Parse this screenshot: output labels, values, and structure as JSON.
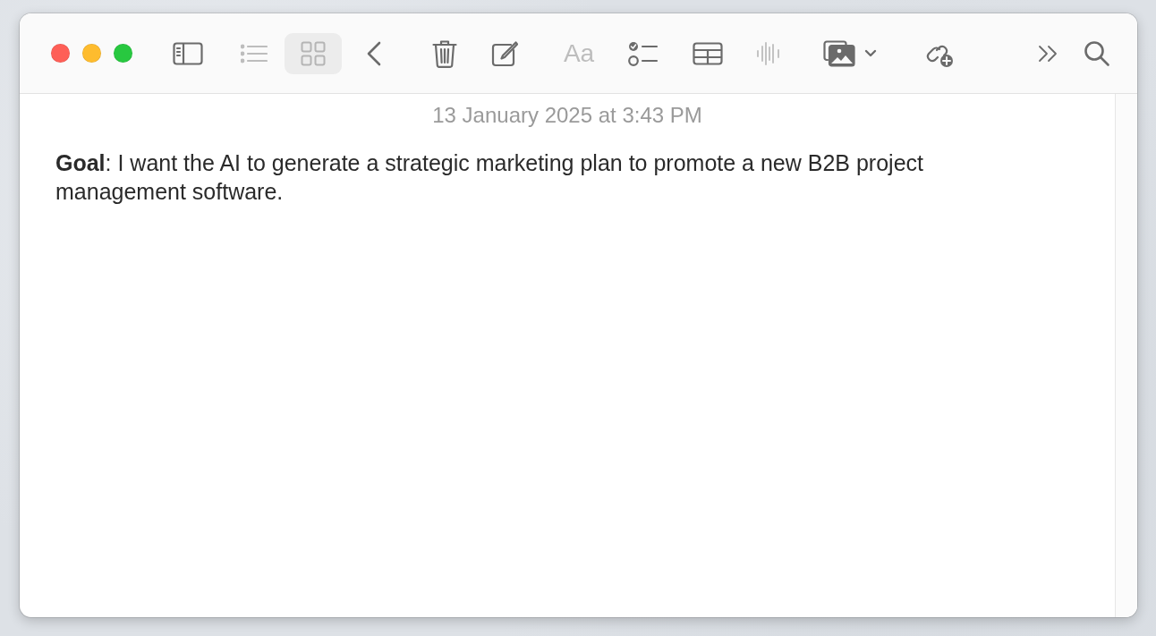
{
  "window": {
    "controls": [
      {
        "kind": "close"
      },
      {
        "kind": "minimize"
      },
      {
        "kind": "zoom"
      }
    ]
  },
  "toolbar": [
    {
      "kind": "sidebar",
      "disabled": false,
      "selected": false
    },
    {
      "kind": "list",
      "disabled": true,
      "selected": false
    },
    {
      "kind": "gallery",
      "disabled": false,
      "selected": true
    },
    {
      "kind": "back",
      "disabled": false,
      "selected": false
    },
    {
      "kind": "delete",
      "disabled": false,
      "selected": false
    },
    {
      "kind": "compose",
      "disabled": false,
      "selected": false
    },
    {
      "kind": "format",
      "disabled": true,
      "selected": false,
      "label": "Aa"
    },
    {
      "kind": "checklist",
      "disabled": false,
      "selected": false
    },
    {
      "kind": "table",
      "disabled": false,
      "selected": false
    },
    {
      "kind": "audio",
      "disabled": true,
      "selected": false
    },
    {
      "kind": "media",
      "disabled": false,
      "selected": false
    },
    {
      "kind": "collaborate",
      "disabled": false,
      "selected": false
    },
    {
      "kind": "more",
      "disabled": false,
      "selected": false
    },
    {
      "kind": "search",
      "disabled": false,
      "selected": false
    }
  ],
  "note": {
    "date": "13 January 2025 at 3:43 PM",
    "body": "**Goal**: I want the AI to generate a strategic marketing plan to promote a new B2B project management software."
  }
}
